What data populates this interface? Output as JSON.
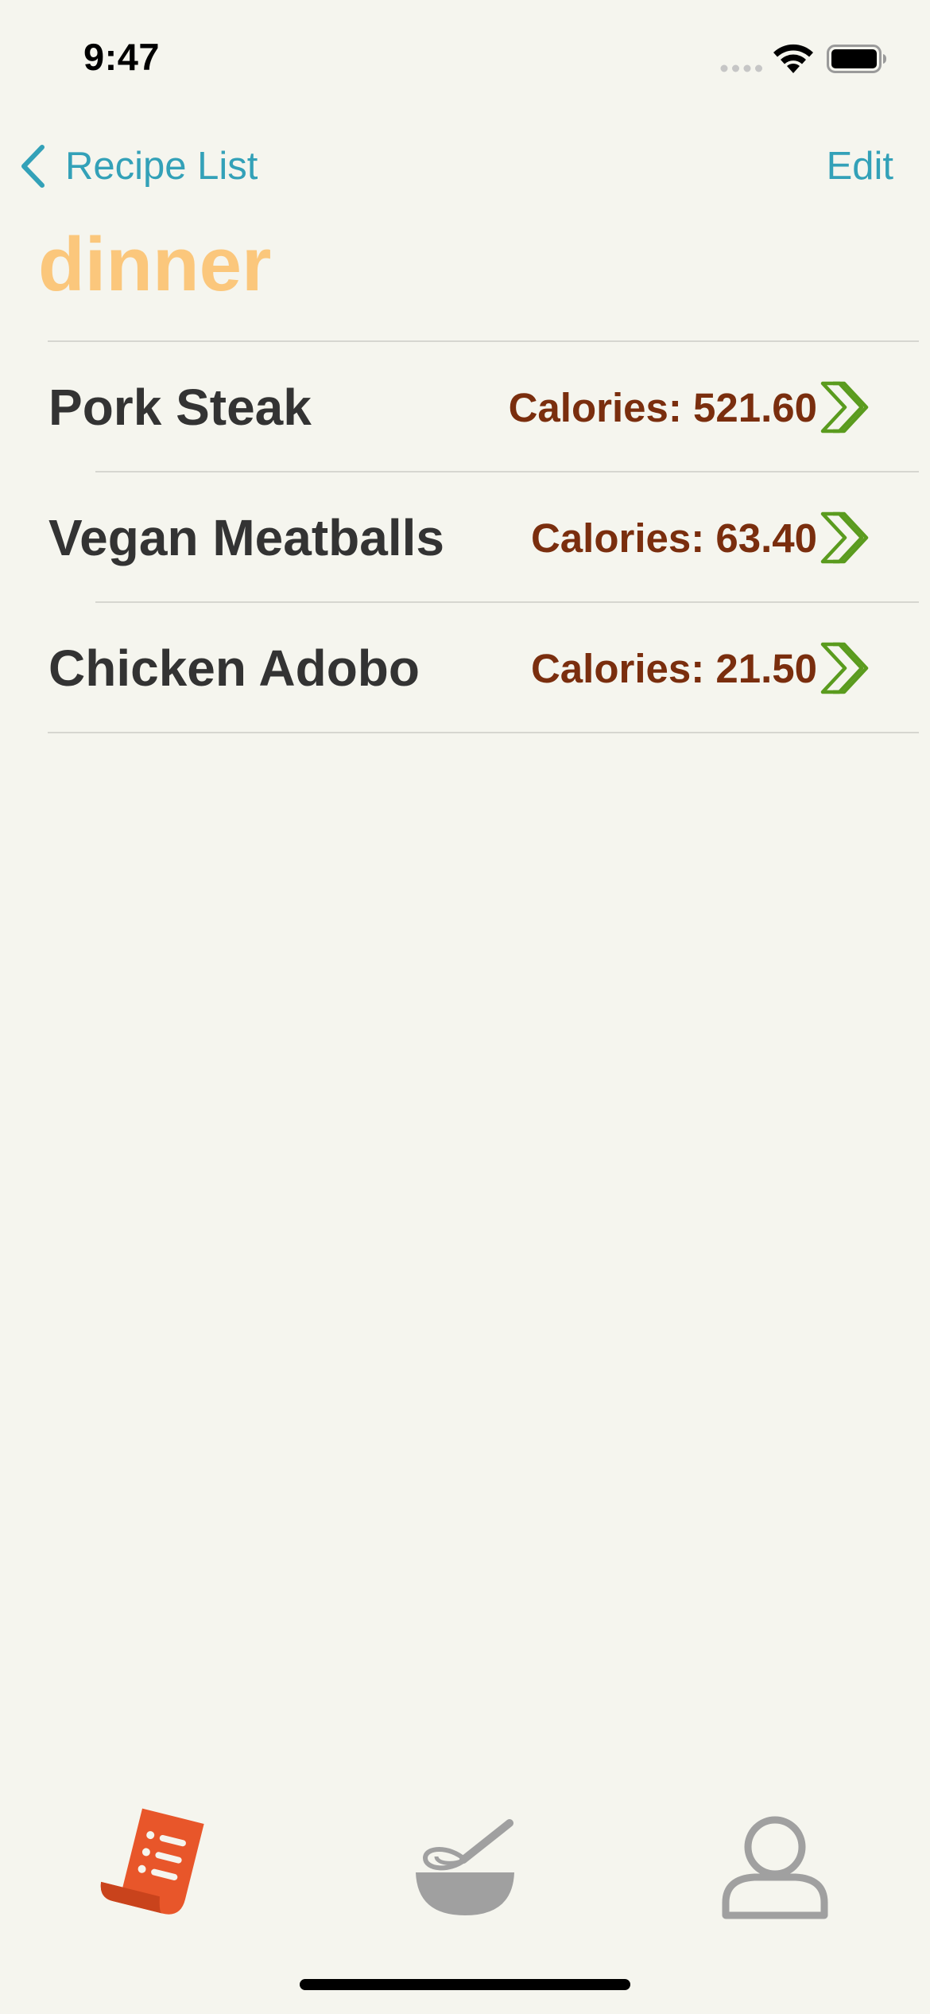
{
  "status_bar": {
    "time": "9:47",
    "signal_icon": "cellular-signal-icon",
    "wifi_icon": "wifi-icon",
    "battery_icon": "battery-icon"
  },
  "nav": {
    "back_label": "Recipe List",
    "back_icon": "chevron-left-icon",
    "edit_label": "Edit"
  },
  "page": {
    "title": "dinner"
  },
  "recipes": [
    {
      "name": "Pork Steak",
      "calories": "Calories: 521.60"
    },
    {
      "name": "Vegan Meatballs",
      "calories": "Calories: 63.40"
    },
    {
      "name": "Chicken Adobo",
      "calories": "Calories: 21.50"
    }
  ],
  "tab_bar": {
    "tabs": [
      {
        "icon": "recipe-list-icon",
        "selected": true
      },
      {
        "icon": "mixing-bowl-whisk-icon",
        "selected": false
      },
      {
        "icon": "user-profile-icon",
        "selected": false
      }
    ]
  },
  "colors": {
    "background": "#f5f5ee",
    "accent_blue": "#33a1b8",
    "title_orange": "#fbc77c",
    "calories_brown": "#7a2e0e",
    "chevron_green": "#5a9b1e",
    "tab_active": "#e8562a",
    "tab_inactive": "#a0a0a0"
  }
}
